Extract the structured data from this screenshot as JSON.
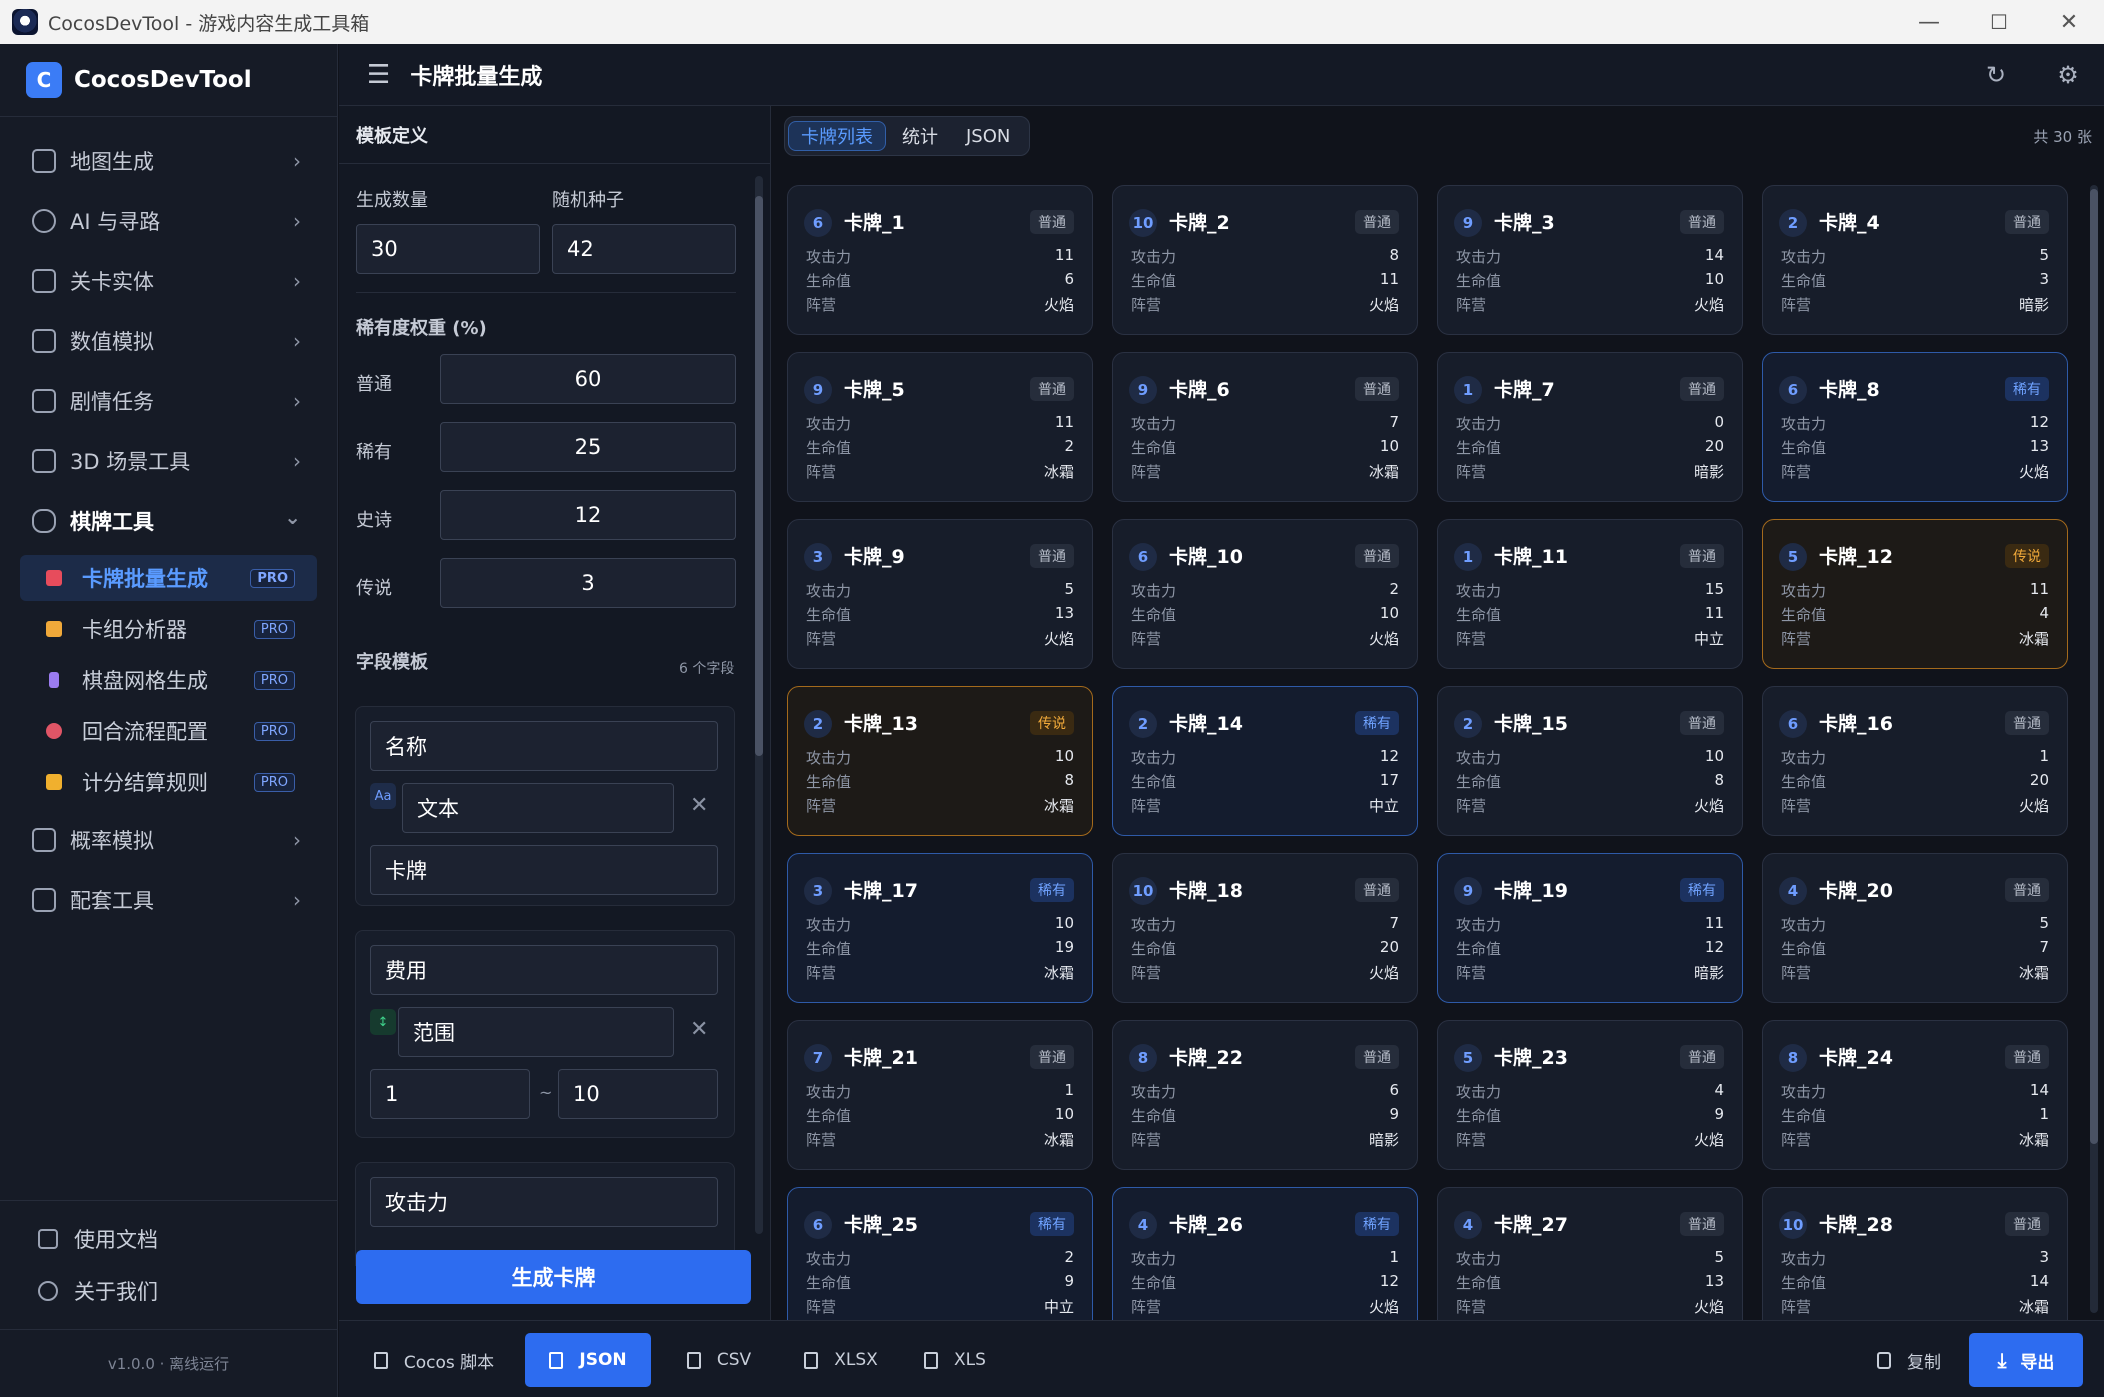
{
  "window": {
    "title": "CocosDevTool - 游戏内容生成工具箱",
    "min": "—",
    "max": "☐",
    "close": "✕"
  },
  "brand": {
    "logo_letter": "C",
    "name": "CocosDevTool"
  },
  "sidebar": {
    "items": [
      {
        "label": "地图生成"
      },
      {
        "label": "AI 与寻路"
      },
      {
        "label": "关卡实体"
      },
      {
        "label": "数值模拟"
      },
      {
        "label": "剧情任务"
      },
      {
        "label": "3D 场景工具"
      }
    ],
    "open_group": {
      "label": "棋牌工具",
      "chevron": "⌄"
    },
    "sub_items": [
      {
        "label": "卡牌批量生成",
        "badge": "PRO",
        "color": "#e74c5c"
      },
      {
        "label": "卡组分析器",
        "badge": "PRO",
        "color": "#f0a93a"
      },
      {
        "label": "棋盘网格生成",
        "badge": "PRO",
        "color": "#9b7cf0"
      },
      {
        "label": "回合流程配置",
        "badge": "PRO",
        "color": "#e05566"
      },
      {
        "label": "计分结算规则",
        "badge": "PRO",
        "color": "#f0b02e"
      }
    ],
    "items_after": [
      {
        "label": "概率模拟"
      },
      {
        "label": "配套工具"
      }
    ],
    "chevron": "›",
    "footer": [
      {
        "label": "使用文档"
      },
      {
        "label": "关于我们"
      }
    ],
    "version": "v1.0.0 · 离线运行"
  },
  "header": {
    "menu_icon": "☰",
    "title": "卡牌批量生成",
    "refresh_icon": "↻",
    "settings_icon": "⚙"
  },
  "template": {
    "heading": "模板定义",
    "count_label": "生成数量",
    "count_value": "30",
    "seed_label": "随机种子",
    "seed_value": "42",
    "rarity_heading": "稀有度权重 (%)",
    "weights": [
      {
        "label": "普通",
        "value": "60"
      },
      {
        "label": "稀有",
        "value": "25"
      },
      {
        "label": "史诗",
        "value": "12"
      },
      {
        "label": "传说",
        "value": "3"
      }
    ],
    "fields_heading": "字段模板",
    "fields_count": "6 个字段",
    "field1": {
      "name": "名称",
      "type_tag": "Aa",
      "type": "文本",
      "value": "卡牌"
    },
    "field2": {
      "name": "费用",
      "type_tag": "↕",
      "type": "范围",
      "min": "1",
      "sep": "~",
      "max": "10"
    },
    "field3": {
      "name": "攻击力"
    },
    "remove_icon": "✕",
    "generate": "生成卡牌"
  },
  "view": {
    "tabs": [
      {
        "label": "卡牌列表"
      },
      {
        "label": "统计"
      },
      {
        "label": "JSON"
      }
    ],
    "total": "共 30 张"
  },
  "stat_labels": {
    "atk": "攻击力",
    "hp": "生命值",
    "faction": "阵营"
  },
  "cards": [
    {
      "cost": "6",
      "name": "卡牌_1",
      "rarity": "普通",
      "atk": "11",
      "hp": "6",
      "faction": "火焰"
    },
    {
      "cost": "10",
      "name": "卡牌_2",
      "rarity": "普通",
      "atk": "8",
      "hp": "11",
      "faction": "火焰"
    },
    {
      "cost": "9",
      "name": "卡牌_3",
      "rarity": "普通",
      "atk": "14",
      "hp": "10",
      "faction": "火焰"
    },
    {
      "cost": "2",
      "name": "卡牌_4",
      "rarity": "普通",
      "atk": "5",
      "hp": "3",
      "faction": "暗影"
    },
    {
      "cost": "9",
      "name": "卡牌_5",
      "rarity": "普通",
      "atk": "11",
      "hp": "2",
      "faction": "冰霜"
    },
    {
      "cost": "9",
      "name": "卡牌_6",
      "rarity": "普通",
      "atk": "7",
      "hp": "10",
      "faction": "冰霜"
    },
    {
      "cost": "1",
      "name": "卡牌_7",
      "rarity": "普通",
      "atk": "0",
      "hp": "20",
      "faction": "暗影"
    },
    {
      "cost": "6",
      "name": "卡牌_8",
      "rarity": "稀有",
      "atk": "12",
      "hp": "13",
      "faction": "火焰"
    },
    {
      "cost": "3",
      "name": "卡牌_9",
      "rarity": "普通",
      "atk": "5",
      "hp": "13",
      "faction": "火焰"
    },
    {
      "cost": "6",
      "name": "卡牌_10",
      "rarity": "普通",
      "atk": "2",
      "hp": "10",
      "faction": "火焰"
    },
    {
      "cost": "1",
      "name": "卡牌_11",
      "rarity": "普通",
      "atk": "15",
      "hp": "11",
      "faction": "中立"
    },
    {
      "cost": "5",
      "name": "卡牌_12",
      "rarity": "传说",
      "atk": "11",
      "hp": "4",
      "faction": "冰霜"
    },
    {
      "cost": "2",
      "name": "卡牌_13",
      "rarity": "传说",
      "atk": "10",
      "hp": "8",
      "faction": "冰霜"
    },
    {
      "cost": "2",
      "name": "卡牌_14",
      "rarity": "稀有",
      "atk": "12",
      "hp": "17",
      "faction": "中立"
    },
    {
      "cost": "2",
      "name": "卡牌_15",
      "rarity": "普通",
      "atk": "10",
      "hp": "8",
      "faction": "火焰"
    },
    {
      "cost": "6",
      "name": "卡牌_16",
      "rarity": "普通",
      "atk": "1",
      "hp": "20",
      "faction": "火焰"
    },
    {
      "cost": "3",
      "name": "卡牌_17",
      "rarity": "稀有",
      "atk": "10",
      "hp": "19",
      "faction": "冰霜"
    },
    {
      "cost": "10",
      "name": "卡牌_18",
      "rarity": "普通",
      "atk": "7",
      "hp": "20",
      "faction": "火焰"
    },
    {
      "cost": "9",
      "name": "卡牌_19",
      "rarity": "稀有",
      "atk": "11",
      "hp": "12",
      "faction": "暗影"
    },
    {
      "cost": "4",
      "name": "卡牌_20",
      "rarity": "普通",
      "atk": "5",
      "hp": "7",
      "faction": "冰霜"
    },
    {
      "cost": "7",
      "name": "卡牌_21",
      "rarity": "普通",
      "atk": "1",
      "hp": "10",
      "faction": "冰霜"
    },
    {
      "cost": "8",
      "name": "卡牌_22",
      "rarity": "普通",
      "atk": "6",
      "hp": "9",
      "faction": "暗影"
    },
    {
      "cost": "5",
      "name": "卡牌_23",
      "rarity": "普通",
      "atk": "4",
      "hp": "9",
      "faction": "火焰"
    },
    {
      "cost": "8",
      "name": "卡牌_24",
      "rarity": "普通",
      "atk": "14",
      "hp": "1",
      "faction": "冰霜"
    },
    {
      "cost": "6",
      "name": "卡牌_25",
      "rarity": "稀有",
      "atk": "2",
      "hp": "9",
      "faction": "中立"
    },
    {
      "cost": "4",
      "name": "卡牌_26",
      "rarity": "稀有",
      "atk": "1",
      "hp": "12",
      "faction": "火焰"
    },
    {
      "cost": "4",
      "name": "卡牌_27",
      "rarity": "普通",
      "atk": "5",
      "hp": "13",
      "faction": "火焰"
    },
    {
      "cost": "10",
      "name": "卡牌_28",
      "rarity": "普通",
      "atk": "3",
      "hp": "14",
      "faction": "冰霜"
    }
  ],
  "export": {
    "formats": [
      {
        "label": "Cocos 脚本"
      },
      {
        "label": "JSON"
      },
      {
        "label": "CSV"
      },
      {
        "label": "XLSX"
      },
      {
        "label": "XLS"
      }
    ],
    "copy": "复制",
    "export": "导出",
    "export_icon": "⤓"
  }
}
